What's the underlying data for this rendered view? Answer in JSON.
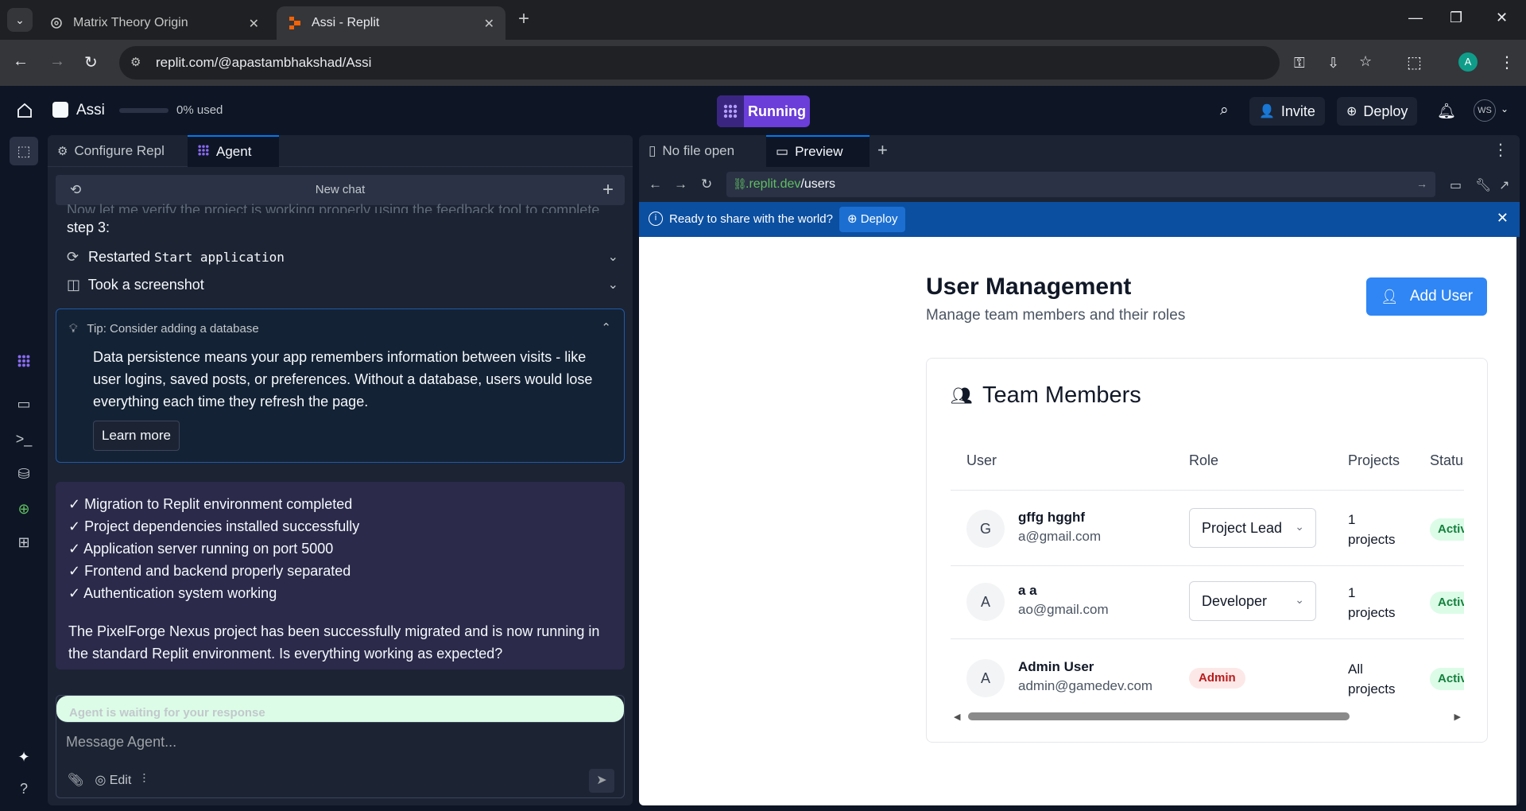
{
  "browser": {
    "tabs": [
      {
        "title": "Matrix Theory Origin",
        "active": false
      },
      {
        "title": "Assi - Replit",
        "active": true
      }
    ],
    "url": "replit.com/@apastambhakshad/Assi",
    "profile_initial": "A"
  },
  "header": {
    "app_name": "Assi",
    "usage_label": "0% used",
    "usage_fraction": 0.0,
    "run_label": "Running",
    "invite_label": "Invite",
    "deploy_label": "Deploy",
    "user_initials": "WS"
  },
  "left_panel": {
    "tabs": [
      {
        "label": "Configure Repl",
        "active": false
      },
      {
        "label": "Agent",
        "active": true
      }
    ],
    "chat_title": "New chat",
    "faded_text": "Now let me verify the project is working properly using the feedback tool to complete",
    "step_text": "step 3:",
    "actions": [
      {
        "prefix": "Restarted",
        "code": "Start application"
      },
      {
        "prefix": "Took a screenshot",
        "code": ""
      }
    ],
    "tip": {
      "title": "Tip: Consider adding a database",
      "body": "Data persistence means your app remembers information between visits - like user logins, saved posts, or preferences. Without a database, users would lose everything each time they refresh the page.",
      "button": "Learn more"
    },
    "message": {
      "checks": [
        "✓ Migration to Replit environment completed",
        "✓ Project dependencies installed successfully",
        "✓ Application server running on port 5000",
        "✓ Frontend and backend properly separated",
        "✓ Authentication system working"
      ],
      "paragraph": "The PixelForge Nexus project has been successfully migrated and is now running in the standard Replit environment. Is everything working as expected?"
    },
    "input": {
      "status": "Agent is waiting for your response",
      "placeholder": "Message Agent...",
      "edit_label": "Edit"
    }
  },
  "right_panel": {
    "tabs": [
      {
        "label": "No file open",
        "active": false
      },
      {
        "label": "Preview",
        "active": true
      }
    ],
    "preview_domain": ".replit.dev",
    "preview_path": "/users",
    "banner_text": "Ready to share with the world?",
    "banner_button": "Deploy",
    "page": {
      "title": "User Management",
      "subtitle": "Manage team members and their roles",
      "add_button": "Add User",
      "card_title": "Team Members",
      "columns": [
        "User",
        "Role",
        "Projects",
        "Status"
      ],
      "users": [
        {
          "initial": "G",
          "name": "gffg hgghf",
          "email": "a@gmail.com",
          "role": "Project Lead",
          "role_type": "select",
          "projects_line1": "1",
          "projects_line2": "projects",
          "status": "Active"
        },
        {
          "initial": "A",
          "name": "a a",
          "email": "ao@gmail.com",
          "role": "Developer",
          "role_type": "select",
          "projects_line1": "1",
          "projects_line2": "projects",
          "status": "Active"
        },
        {
          "initial": "A",
          "name": "Admin User",
          "email": "admin@gamedev.com",
          "role": "Admin",
          "role_type": "badge",
          "projects_line1": "All",
          "projects_line2": "projects",
          "status": "Active"
        }
      ]
    }
  },
  "colors": {
    "ide_bg": "#0e1525",
    "panel_bg": "#1c2333",
    "run_accent": "#6b3dd9",
    "link_blue": "#0079f2",
    "add_user_blue": "#2f86f4",
    "banner_blue": "#0b4fa1"
  }
}
